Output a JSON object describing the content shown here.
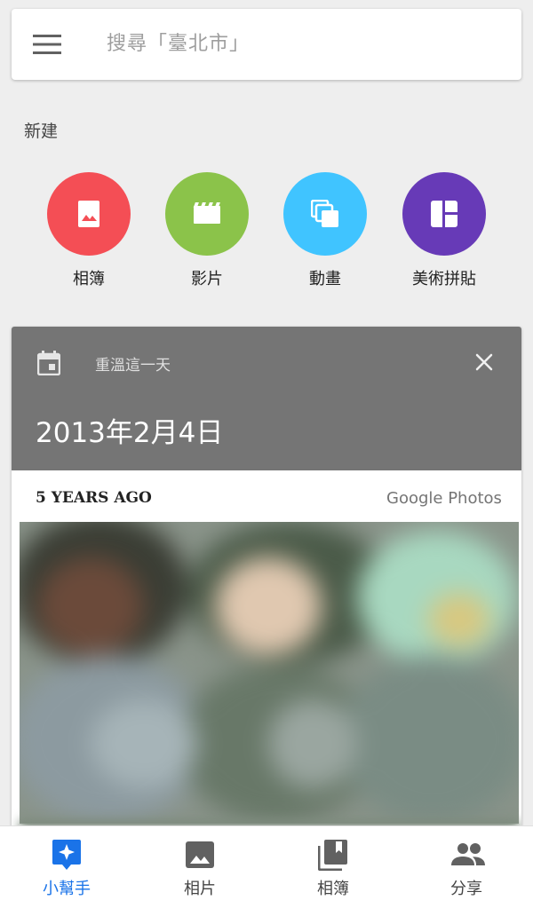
{
  "search": {
    "placeholder": "搜尋「臺北市」"
  },
  "create_section": {
    "label": "新建",
    "items": [
      {
        "label": "相簿",
        "icon": "album-icon",
        "color": "#f44e55"
      },
      {
        "label": "影片",
        "icon": "movie-icon",
        "color": "#8bc34a"
      },
      {
        "label": "動畫",
        "icon": "animation-icon",
        "color": "#40c4ff"
      },
      {
        "label": "美術拼貼",
        "icon": "collage-icon",
        "color": "#673ab7"
      }
    ]
  },
  "memory_card": {
    "kicker": "重溫這一天",
    "date": "2013年2月4日",
    "years_ago": "5 YEARS AGO",
    "brand": "Google Photos",
    "header_color": "#757575"
  },
  "bottom_nav": {
    "items": [
      {
        "label": "小幫手",
        "icon": "assistant-icon",
        "active": true
      },
      {
        "label": "相片",
        "icon": "photo-icon",
        "active": false
      },
      {
        "label": "相簿",
        "icon": "albums-icon",
        "active": false
      },
      {
        "label": "分享",
        "icon": "people-icon",
        "active": false
      }
    ],
    "active_color": "#1a73e8"
  }
}
